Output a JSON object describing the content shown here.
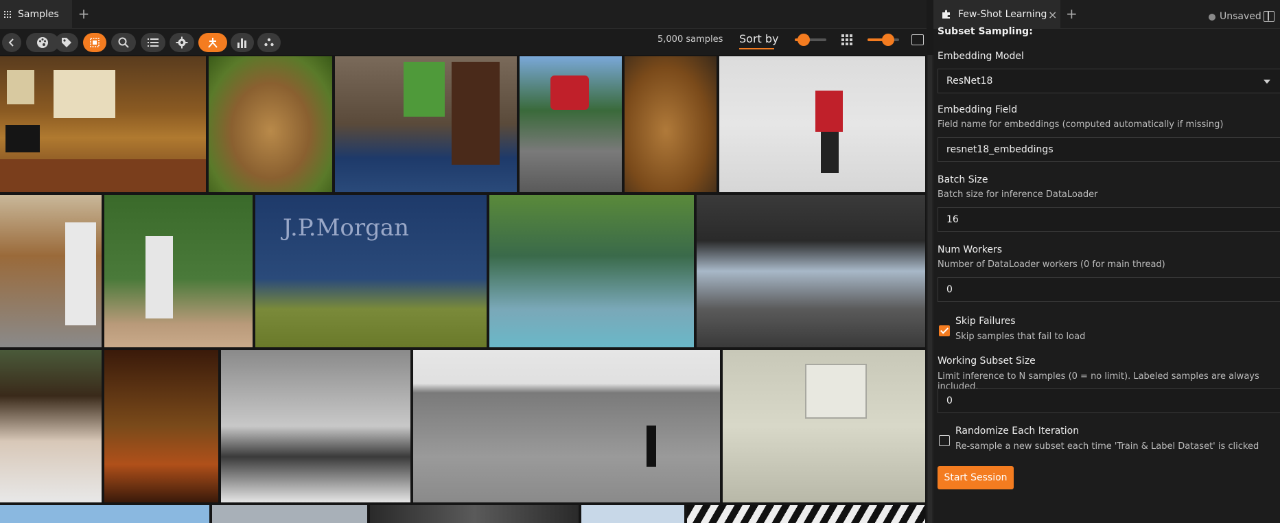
{
  "left_tab": {
    "label": "Samples",
    "add_label": "+"
  },
  "toolbar": {
    "sample_count": "5,000 samples",
    "sort_label": "Sort by",
    "sliders": [
      {
        "value": 0.15
      },
      {
        "value": 0.75
      }
    ]
  },
  "gallery": {
    "rows": [
      {
        "tiles": [
          "living-room",
          "brown-bear",
          "bedroom",
          "stop-sign",
          "teddy-bears",
          "skier"
        ]
      },
      {
        "tiles": [
          "kitchen",
          "baseball-players",
          "tennis-player",
          "group-of-kids",
          "bridge-river"
        ]
      },
      {
        "tiles": [
          "woman-phone",
          "kids-ride",
          "sandwich-plate",
          "paddleboarder",
          "computer-desk"
        ]
      },
      {
        "tiles": [
          "sky",
          "rooftop",
          "animal",
          "airplane",
          "zebra"
        ]
      }
    ]
  },
  "right_tab": {
    "label": "Few-Shot Learning",
    "close_label": "×",
    "add_label": "+",
    "status": "Unsaved"
  },
  "form": {
    "section_title": "Subset Sampling:",
    "embedding_model": {
      "label": "Embedding Model",
      "value": "ResNet18"
    },
    "embedding_field": {
      "label": "Embedding Field",
      "desc": "Field name for embeddings (computed automatically if missing)",
      "value": "resnet18_embeddings"
    },
    "batch_size": {
      "label": "Batch Size",
      "desc": "Batch size for inference DataLoader",
      "value": "16"
    },
    "num_workers": {
      "label": "Num Workers",
      "desc": "Number of DataLoader workers (0 for main thread)",
      "value": "0"
    },
    "skip_failures": {
      "label": "Skip Failures",
      "desc": "Skip samples that fail to load",
      "checked": true
    },
    "working_subset": {
      "label": "Working Subset Size",
      "desc": "Limit inference to N samples (0 = no limit). Labeled samples are always included.",
      "value": "0"
    },
    "randomize": {
      "label": "Randomize Each Iteration",
      "desc": "Re-sample a new subset each time 'Train & Label Dataset' is clicked",
      "checked": false
    },
    "start_label": "Start Session"
  },
  "colors": {
    "accent": "#f47c20",
    "panel": "#1c1c1c",
    "input_border": "#3b3b3b"
  }
}
